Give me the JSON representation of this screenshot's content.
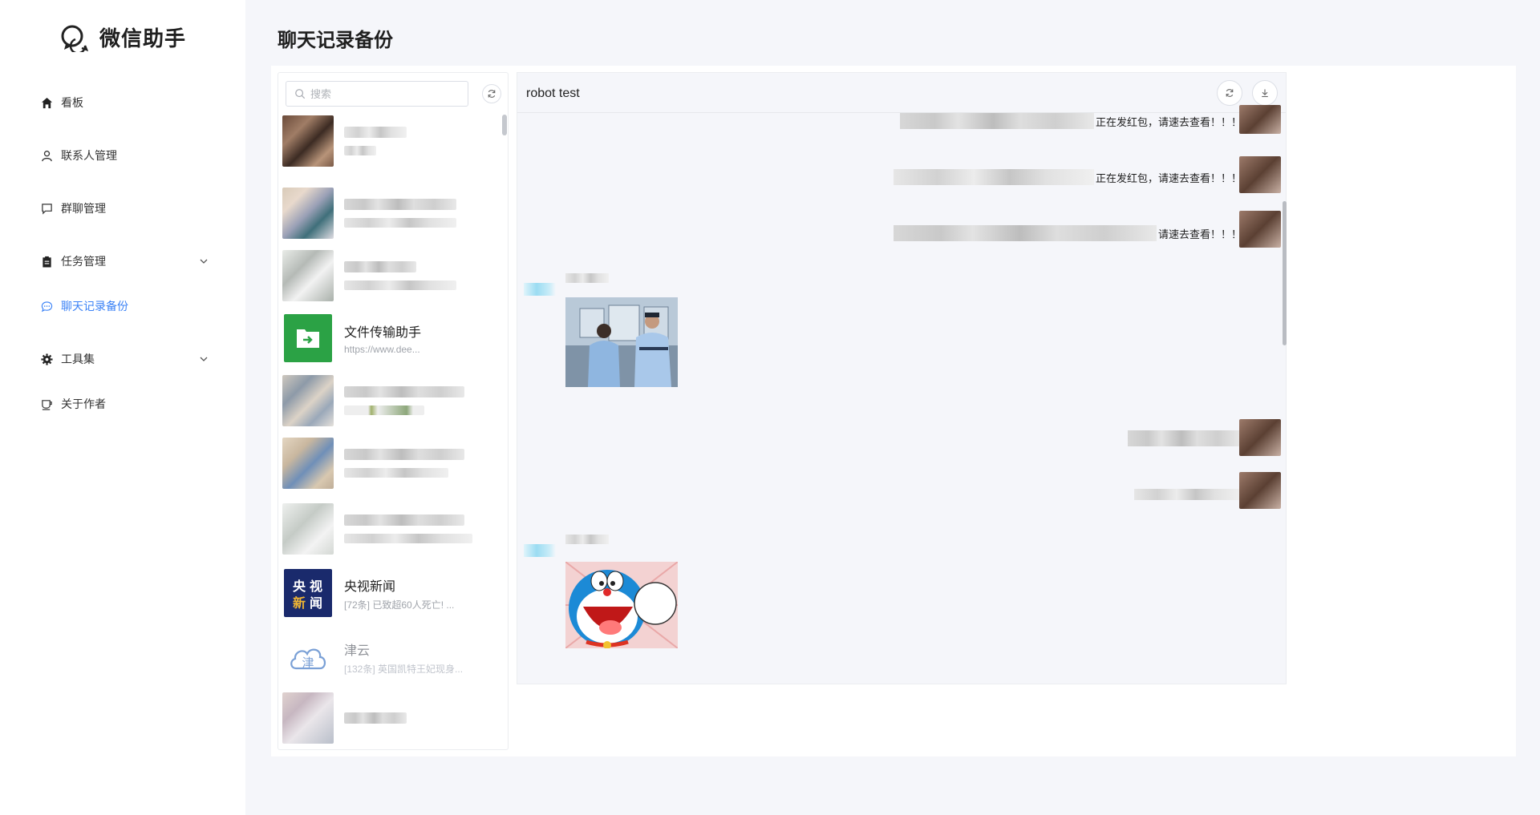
{
  "app": {
    "name": "微信助手",
    "page_title": "聊天记录备份"
  },
  "sidebar": {
    "items": [
      {
        "label": "看板",
        "icon": "home-icon"
      },
      {
        "label": "联系人管理",
        "icon": "user-icon"
      },
      {
        "label": "群聊管理",
        "icon": "chat-square-icon"
      },
      {
        "label": "任务管理",
        "icon": "clipboard-icon",
        "expandable": true
      },
      {
        "label": "聊天记录备份",
        "icon": "chat-dots-icon",
        "active": true
      },
      {
        "label": "工具集",
        "icon": "gear-icon",
        "expandable": true
      },
      {
        "label": "关于作者",
        "icon": "coffee-cup-icon"
      }
    ]
  },
  "chat_list": {
    "search_placeholder": "搜索",
    "contacts": [
      {
        "name": "",
        "preview": "",
        "redacted": true
      },
      {
        "name": "",
        "preview": "",
        "redacted": true
      },
      {
        "name": "",
        "preview": "",
        "redacted": true
      },
      {
        "name": "文件传输助手",
        "preview": "https://www.dee...",
        "avatar": "file-transfer-icon"
      },
      {
        "name": "",
        "preview": "",
        "redacted": true
      },
      {
        "name": "",
        "preview": "",
        "redacted": true
      },
      {
        "name": "",
        "preview": "",
        "redacted": true
      },
      {
        "name": "央视新闻",
        "preview": "[72条] 已致超60人死亡! ...",
        "avatar": "cctv-news-logo"
      },
      {
        "name": "津云",
        "preview": "[132条] 英国凯特王妃现身...",
        "avatar": "jinyun-cloud-logo",
        "muted": true
      },
      {
        "name": "",
        "preview": "",
        "redacted": true
      }
    ]
  },
  "chat": {
    "title": "robot test",
    "buttons": {
      "refresh": "refresh-icon",
      "download": "download-icon"
    },
    "messages": [
      {
        "side": "right",
        "text": "正在发红包，请速去查看！！！"
      },
      {
        "side": "right",
        "text": "正在发红包，请速去查看！！！"
      },
      {
        "side": "right",
        "text": "请速去查看！！！"
      },
      {
        "side": "left",
        "type": "image",
        "image": "two-policemen-photo"
      },
      {
        "side": "right",
        "text": ""
      },
      {
        "side": "right",
        "text": ""
      },
      {
        "side": "left",
        "type": "image",
        "image": "doraemon-sticker"
      }
    ]
  },
  "colors": {
    "accent": "#3b82f6",
    "background": "#f5f6fa",
    "file_transfer_green": "#2ba245",
    "cctv_blue": "#1a2a6c"
  }
}
